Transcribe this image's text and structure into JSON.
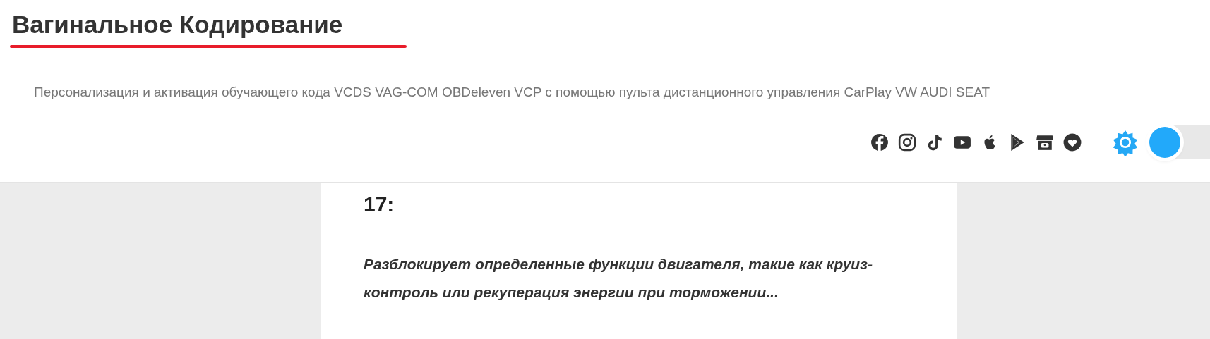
{
  "site_title": "Вагинальное Кодирование",
  "tagline": "Персонализация и активация обучающего кода VCDS VAG-COM OBDeleven VCP с помощью пульта дистанционного управления CarPlay VW AUDI SEAT",
  "social_icons": [
    {
      "kind": "facebook"
    },
    {
      "kind": "instagram"
    },
    {
      "kind": "tiktok"
    },
    {
      "kind": "youtube"
    },
    {
      "kind": "apple"
    },
    {
      "kind": "play"
    },
    {
      "kind": "store"
    },
    {
      "kind": "heart"
    }
  ],
  "dark_mode": {
    "on": false
  },
  "article": {
    "heading": "17:",
    "summary": "Разблокирует определенные функции двигателя, такие как круиз-контроль или рекуперация энергии при торможении..."
  }
}
